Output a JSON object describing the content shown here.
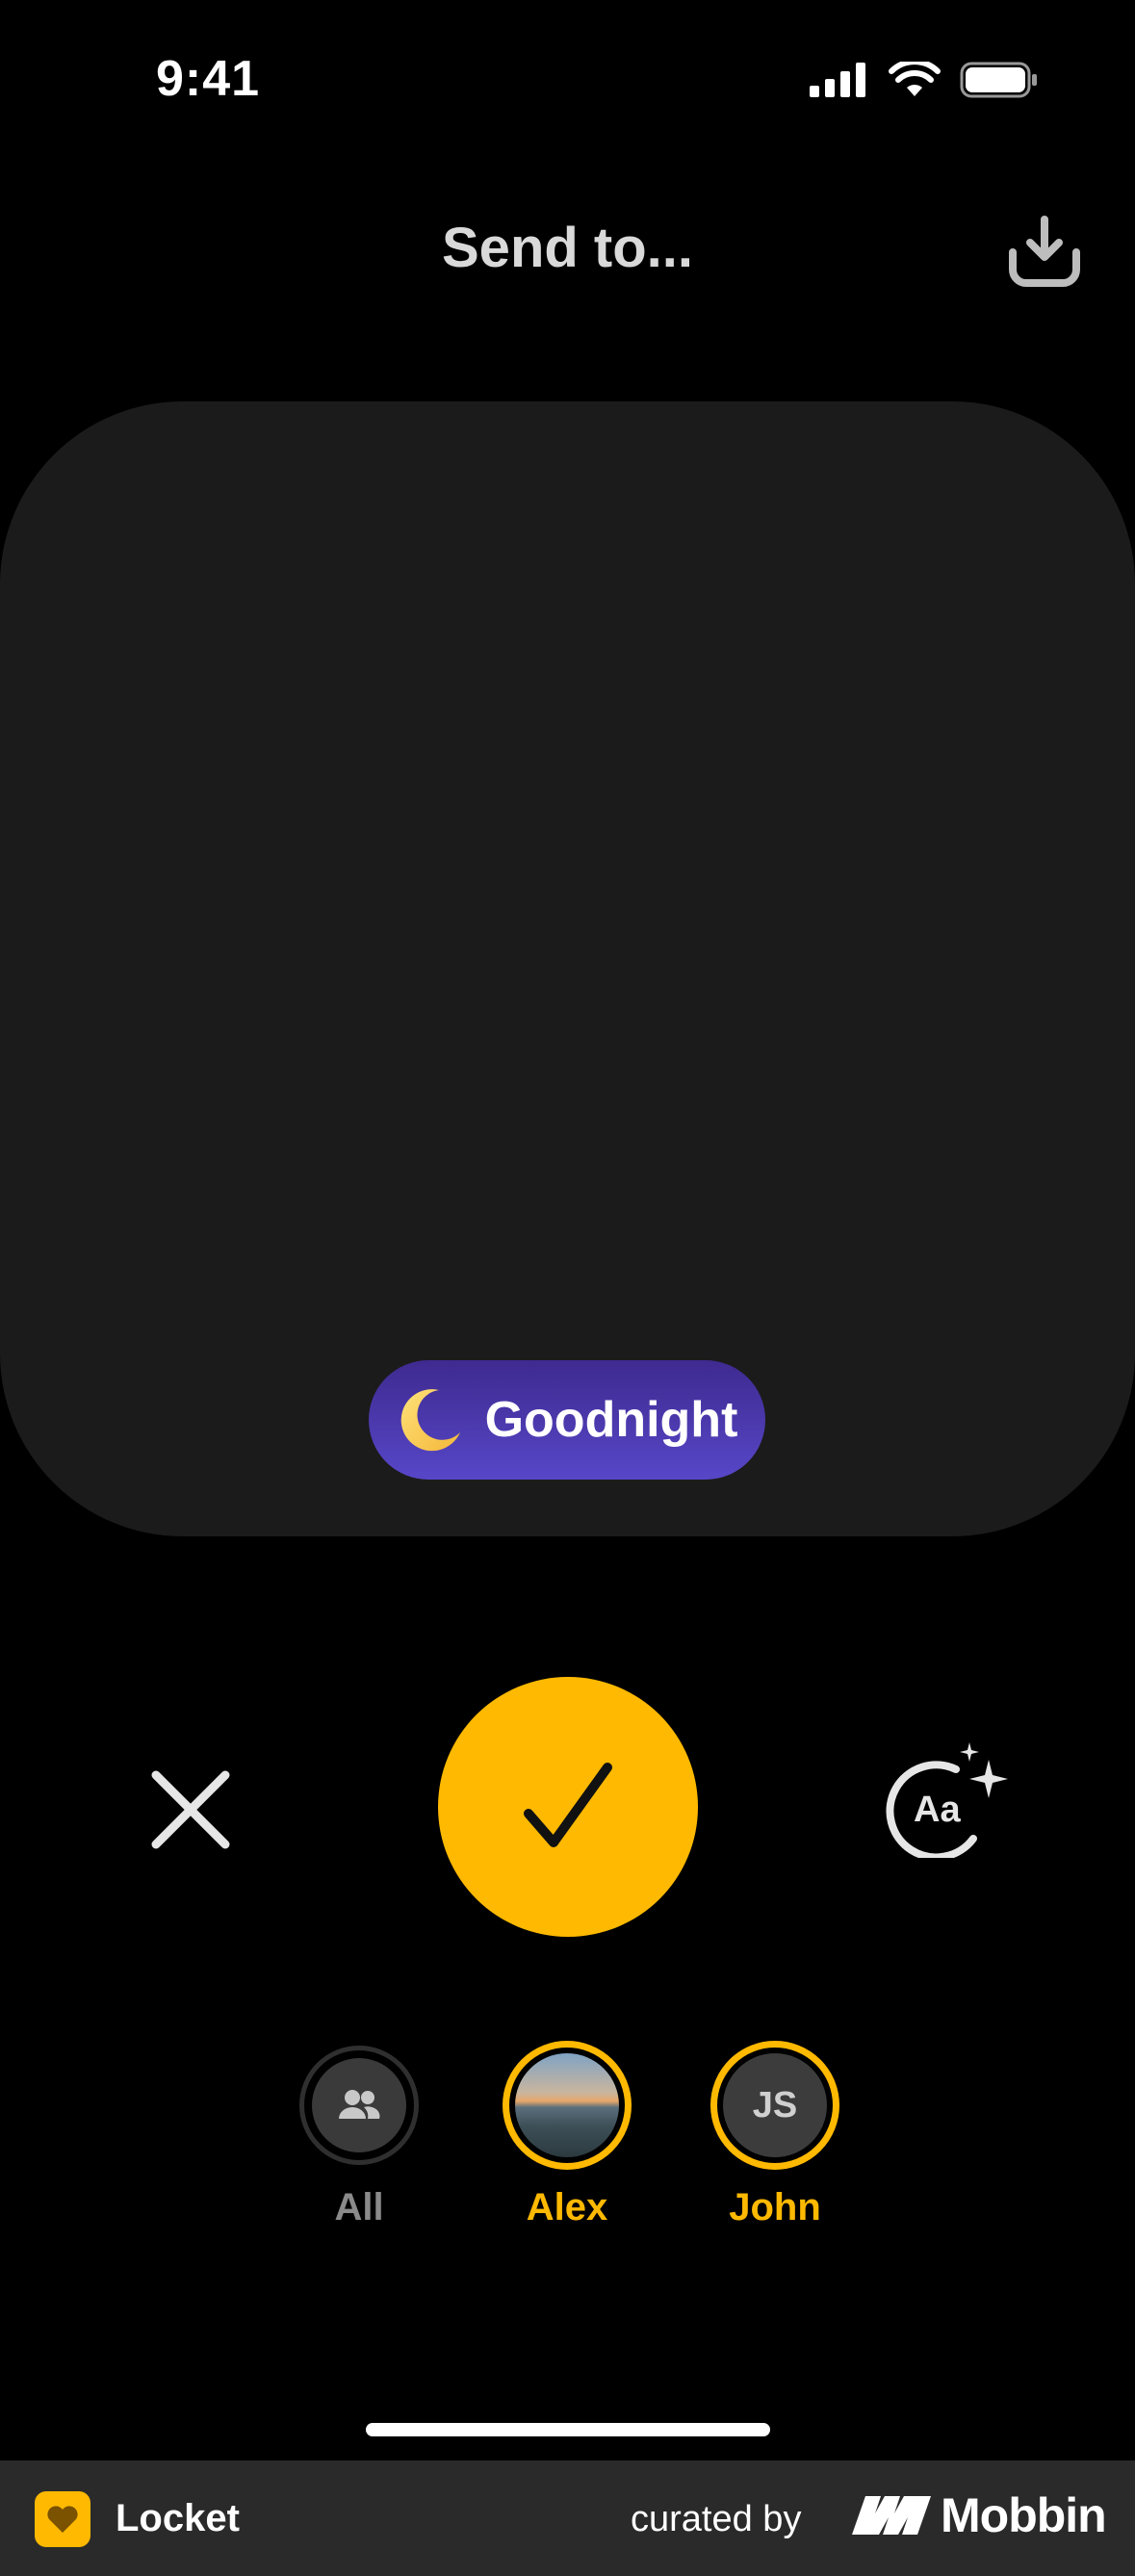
{
  "status_bar": {
    "time": "9:41"
  },
  "header": {
    "title": "Send to..."
  },
  "preview": {
    "mood_label": "Goodnight"
  },
  "recipients": [
    {
      "name": "All"
    },
    {
      "name": "Alex"
    },
    {
      "name": "John",
      "initials": "JS"
    }
  ],
  "footer": {
    "app_name": "Locket",
    "curated_by": "curated by",
    "brand": "Mobbin"
  },
  "colors": {
    "accent": "#ffb900",
    "background": "#000000",
    "preview": "#1b1b1b",
    "pill": "#4a3aad"
  }
}
